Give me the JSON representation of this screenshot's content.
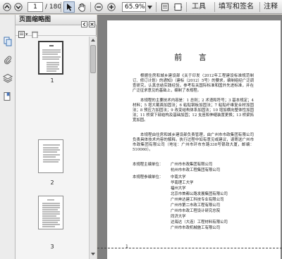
{
  "toolbar": {
    "current_page": "1",
    "total_pages": "/ 180",
    "zoom": "65.9%",
    "tools_label": "工具",
    "fill_sign_label": "填写和签名",
    "comment_label": "注释"
  },
  "panel": {
    "title": "页面缩略图",
    "thumbnails": [
      {
        "label": "1"
      },
      {
        "label": "2"
      },
      {
        "label": "3"
      }
    ]
  },
  "document": {
    "title": "前 言",
    "paragraphs": [
      "根据住房和城乡建设部《关于印发〈2012年工程建设标准规范制订、修订计划〉的通知》（建标〔2012〕5号）的要求，编制组经广泛调查研究，认真总结实践经验，参考有关国际标准和国外先进标准，并在广泛征求意见的基础上，编制了本规程。",
      "本规程的主要技术内容是：1 总则；2 术语和符号；3 基本规定；4 材料；5 增大截面加固法；6 粘贴钢板加固法；7 粘贴纤维复合材加固法；8 预应力加固法；9 改变结构体系加固法；10 增加横向整体性加固法；11 桥梁下部结构及基础加固；12 支座和伸缩装置更换；13 桥梁拓宽加固。",
      "本规程由住房和城乡建设部负责管理，由广州市市政集团有限公司负责具体技术内容的解释。执行过程中如有意见或建议，请寄送广州市市政集团有限公司（地址：广州市环市东路338号银政大厦，邮编：510060）。"
    ],
    "chief_label": "本规程主编单位：",
    "chief_units": [
      "广州市市政集团有限公司",
      "杭州市市政工程集团有限公司"
    ],
    "participants_label": "本规程参编单位：",
    "participant_units": [
      "中南大学",
      "华南理工大学",
      "福州大学",
      "北京市首都公路发展集团有限公司",
      "广州奔达建工科技专业有限公司",
      "广州市第二市政工程有限公司",
      "广州市市政工程设计研究总院",
      "同济大学",
      "达海达（大连）工程材料有限公司",
      "广州市市政机械施工有限公司"
    ],
    "page_number": "1"
  }
}
